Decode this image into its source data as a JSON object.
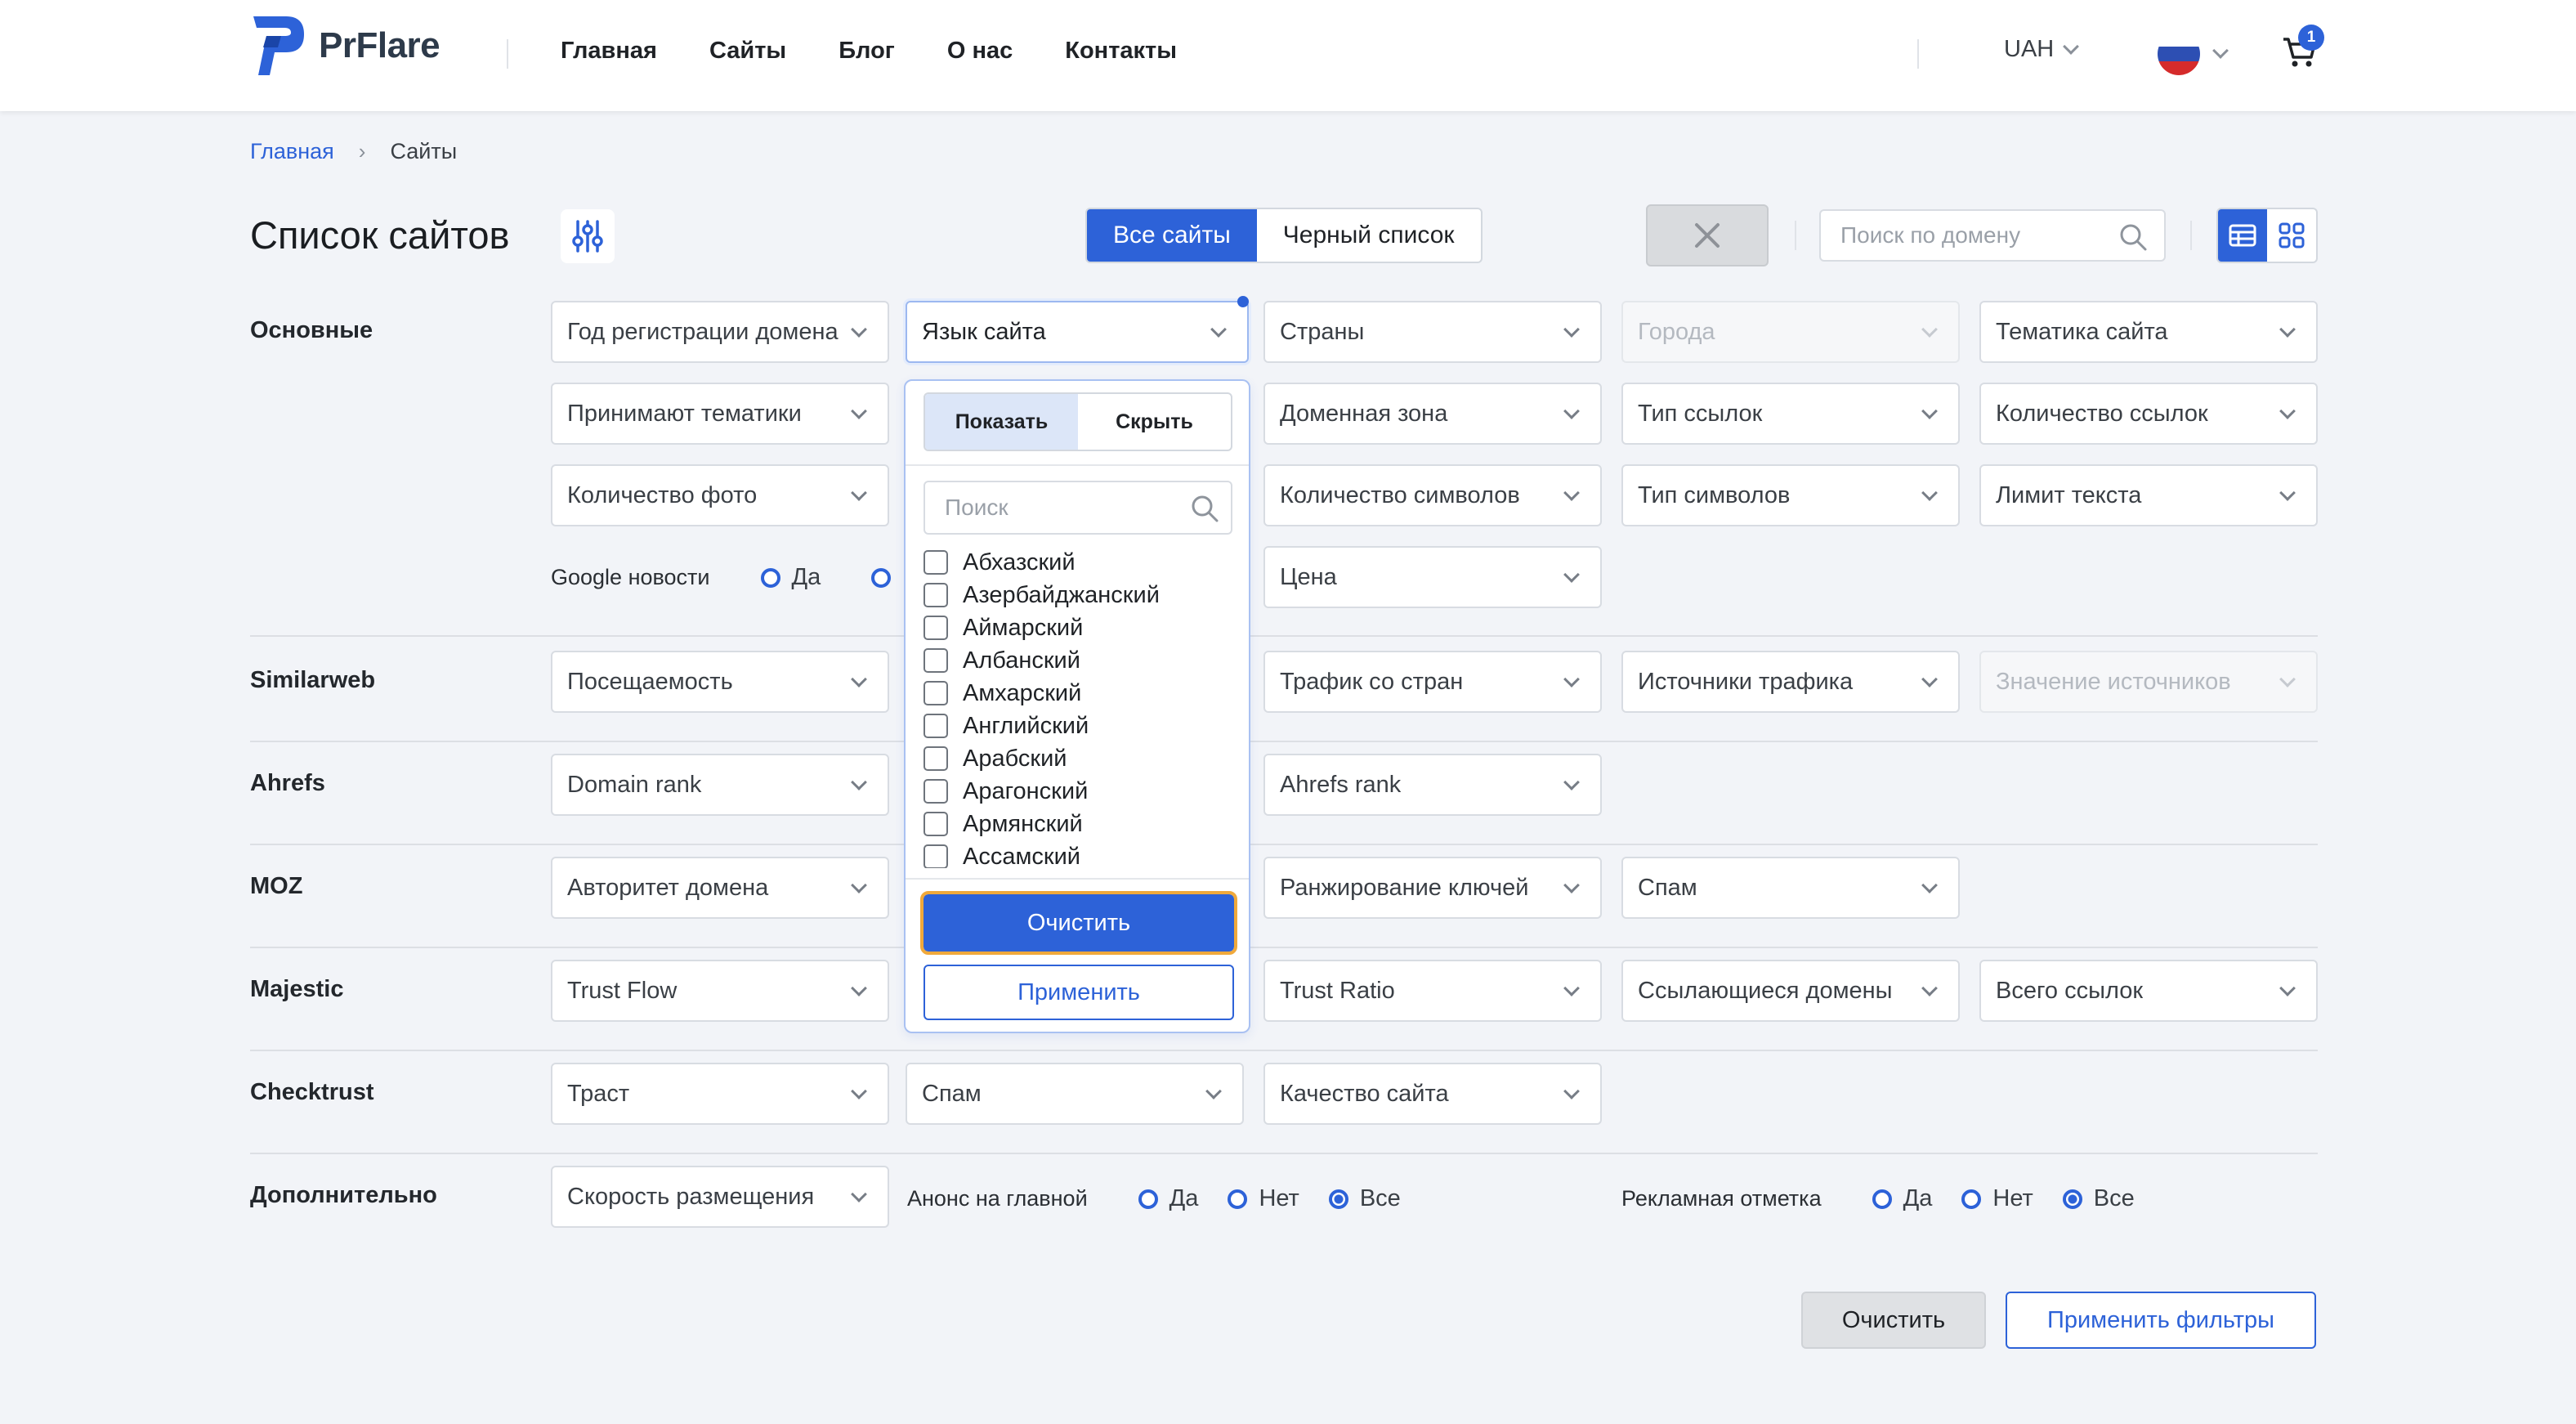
{
  "header": {
    "logo_text": "PrFlare",
    "nav": [
      "Главная",
      "Сайты",
      "Блог",
      "О нас",
      "Контакты"
    ],
    "currency": "UAH",
    "cart_count": "1"
  },
  "breadcrumb": {
    "home": "Главная",
    "separator": "›",
    "current": "Сайты"
  },
  "title": "Список сайтов",
  "tabs": {
    "all": "Все сайты",
    "blacklist": "Черный список"
  },
  "search": {
    "placeholder": "Поиск по домену"
  },
  "sections": {
    "main": "Основные",
    "similarweb": "Similarweb",
    "ahrefs": "Ahrefs",
    "moz": "MOZ",
    "majestic": "Majestic",
    "checktrust": "Checktrust",
    "extra": "Дополнительно"
  },
  "filters": {
    "domain_year": "Год регистрации домена",
    "site_language": "Язык сайта",
    "countries": "Страны",
    "cities": "Города",
    "site_topic": "Тематика сайта",
    "accept_topics": "Принимают тематики",
    "domain_zone": "Доменная зона",
    "link_type": "Тип ссылок",
    "link_count": "Количество ссылок",
    "photo_count": "Количество фото",
    "char_count": "Количество символов",
    "char_type": "Тип символов",
    "text_limit": "Лимит текста",
    "google_news": "Google новости",
    "yes": "Да",
    "no": "Нет",
    "all": "Все",
    "price": "Цена",
    "traffic": "Посещаемость",
    "country_traffic": "Трафик со стран",
    "traffic_sources": "Источники трафика",
    "source_value": "Значение источников",
    "domain_rank": "Domain rank",
    "ahrefs_rank": "Ahrefs rank",
    "domain_authority": "Авторитет домена",
    "keyword_ranking": "Ранжирование ключей",
    "moz_spam": "Спам",
    "trust_flow": "Trust Flow",
    "trust_ratio": "Trust Ratio",
    "ref_domains": "Ссылающиеся домены",
    "total_links": "Всего ссылок",
    "trust": "Траст",
    "ct_spam": "Спам",
    "site_quality": "Качество сайта",
    "placement_speed": "Скорость размещения",
    "homepage_announce": "Анонс на главной",
    "ad_mark": "Рекламная отметка"
  },
  "language_panel": {
    "show": "Показать",
    "hide": "Скрыть",
    "search_placeholder": "Поиск",
    "languages": [
      "Абхазский",
      "Азербайджанский",
      "Аймарский",
      "Албанский",
      "Амхарский",
      "Английский",
      "Арабский",
      "Арагонский",
      "Армянский",
      "Ассамский"
    ],
    "clear": "Очистить",
    "apply": "Применить"
  },
  "actions": {
    "clear": "Очистить",
    "apply": "Применить фильтры"
  },
  "colors": {
    "accent": "#2d62d8",
    "focus_outline": "#f0a93b"
  }
}
